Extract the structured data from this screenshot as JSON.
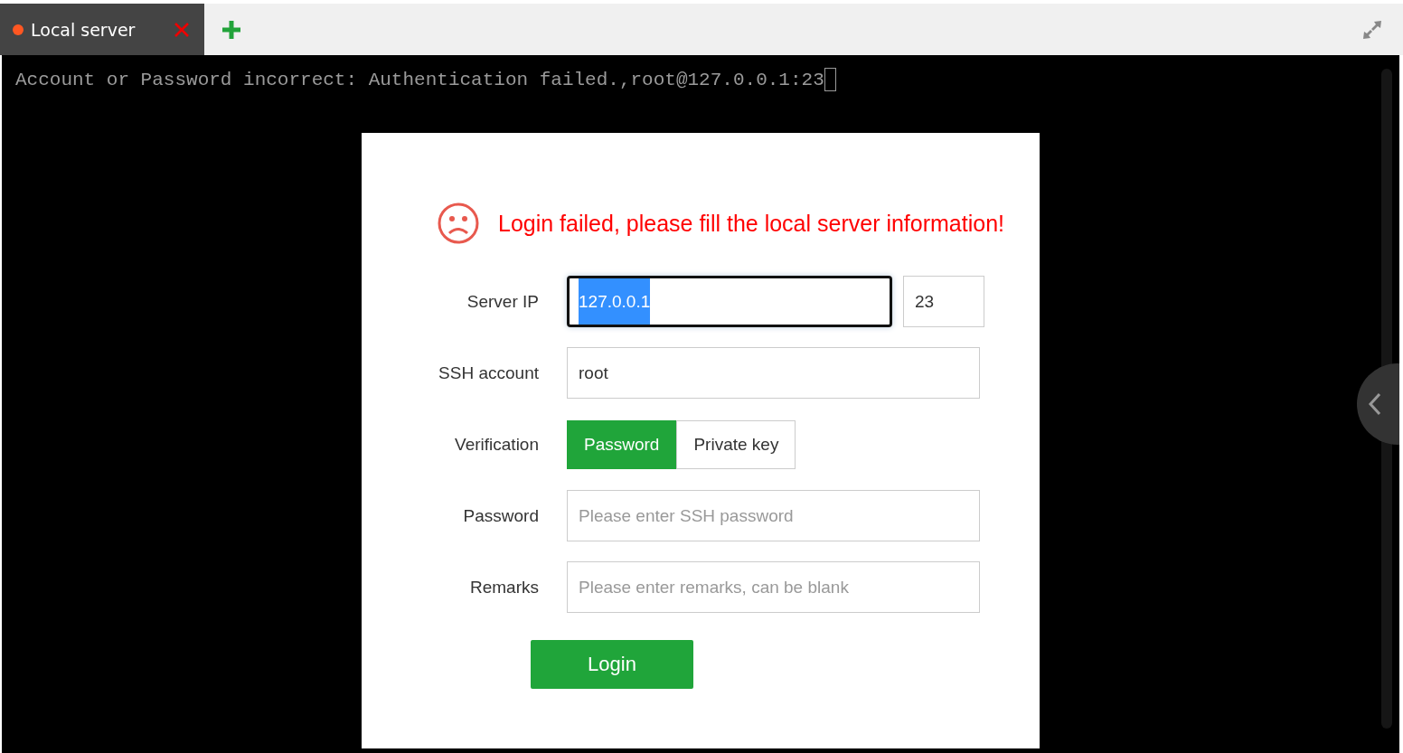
{
  "tabs": [
    {
      "label": "Local server",
      "selected": true,
      "color": "#ff5722"
    }
  ],
  "terminal": {
    "line": "Account or Password incorrect: Authentication failed.,root@127.0.0.1:23"
  },
  "dialog": {
    "message": "Login failed, please fill the local server information!",
    "rows": [
      {
        "kind": "host",
        "label": "Server IP",
        "value": "127.0.0.1",
        "focused": true,
        "port": "23"
      },
      {
        "kind": "text",
        "label": "SSH account",
        "value": "root"
      },
      {
        "kind": "toggle",
        "label": "Verification",
        "options": [
          {
            "label": "Password",
            "selected": true
          },
          {
            "label": "Private key",
            "selected": false
          }
        ]
      },
      {
        "kind": "text",
        "label": "Password",
        "placeholder": "Please enter SSH password"
      },
      {
        "kind": "text",
        "label": "Remarks",
        "placeholder": "Please enter remarks, can be blank"
      }
    ],
    "button": "Login"
  }
}
